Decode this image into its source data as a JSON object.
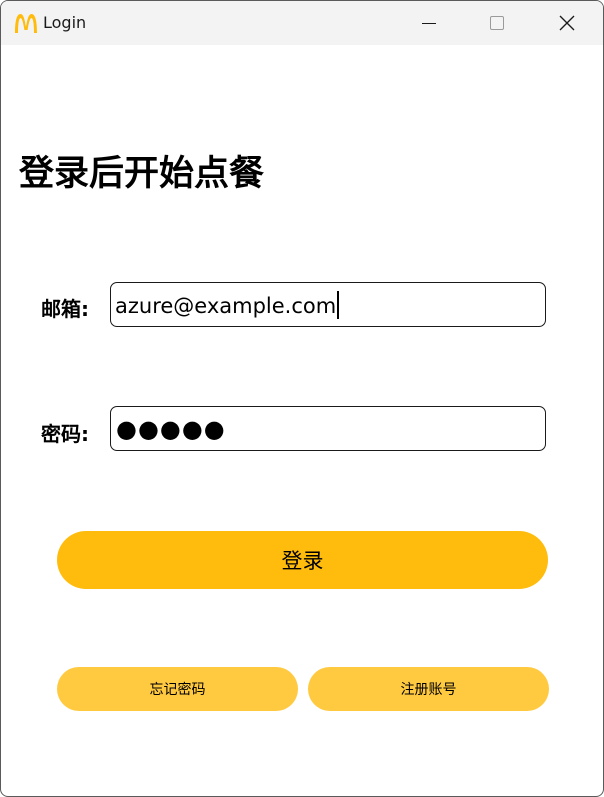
{
  "window": {
    "title": "Login",
    "controls": {
      "minimize_icon": "minimize-icon",
      "maximize_icon": "maximize-icon",
      "close_icon": "close-icon"
    }
  },
  "colors": {
    "brand_yellow": "#ffbc0d",
    "secondary_yellow": "#ffc940",
    "titlebar_bg": "#f3f3f3"
  },
  "main": {
    "heading": "登录后开始点餐",
    "email": {
      "label": "邮箱:",
      "value": "azure@example.com"
    },
    "password": {
      "label": "密码:",
      "masked_value": "●●●●●"
    },
    "login_button": "登录",
    "forgot_button": "忘记密码",
    "register_button": "注册账号"
  }
}
